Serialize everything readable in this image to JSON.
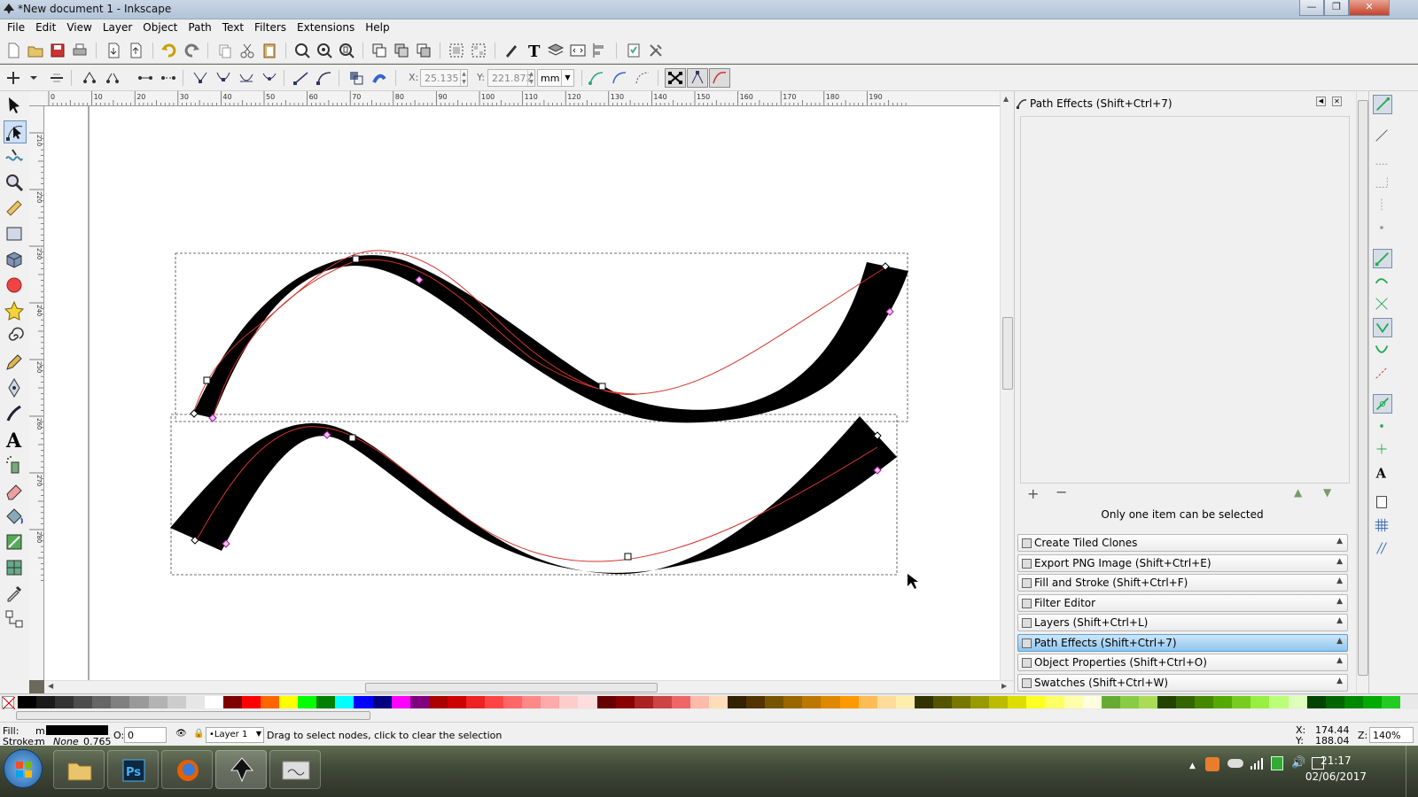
{
  "window": {
    "title": "*New document 1 - Inkscape"
  },
  "menu": [
    "File",
    "Edit",
    "View",
    "Layer",
    "Object",
    "Path",
    "Text",
    "Filters",
    "Extensions",
    "Help"
  ],
  "node_toolbar": {
    "x_label": "X:",
    "x_value": "25.135",
    "y_label": "Y:",
    "y_value": "221.872",
    "unit": "mm"
  },
  "ruler_h": [
    "0",
    "10",
    "20",
    "30",
    "40",
    "50",
    "60",
    "70",
    "80",
    "90",
    "100",
    "110",
    "120",
    "130",
    "140",
    "150",
    "160",
    "170",
    "180",
    "190"
  ],
  "ruler_v": [
    "210",
    "220",
    "230",
    "240",
    "250",
    "260",
    "270",
    "280"
  ],
  "dock": {
    "title": "Path Effects  (Shift+Ctrl+7)",
    "hint": "Only one item can be selected",
    "panels": [
      {
        "label": "Create Tiled Clones",
        "active": false
      },
      {
        "label": "Export PNG Image (Shift+Ctrl+E)",
        "active": false
      },
      {
        "label": "Fill and Stroke (Shift+Ctrl+F)",
        "active": false
      },
      {
        "label": "Filter Editor",
        "active": false
      },
      {
        "label": "Layers (Shift+Ctrl+L)",
        "active": false
      },
      {
        "label": "Path Effects  (Shift+Ctrl+7)",
        "active": true
      },
      {
        "label": "Object Properties (Shift+Ctrl+O)",
        "active": false
      },
      {
        "label": "Swatches (Shift+Ctrl+W)",
        "active": false
      }
    ]
  },
  "status": {
    "fill_label": "Fill:",
    "fill_value": "m",
    "stroke_label": "Stroke:",
    "stroke_value": "m",
    "stroke_none": "None",
    "stroke_width": "0.765",
    "opacity_label": "O:",
    "opacity_value": "0",
    "layer": "•Layer 1",
    "message": "Drag to select nodes, click to clear the selection",
    "cursor_x_label": "X:",
    "cursor_x": "174.44",
    "cursor_y_label": "Y:",
    "cursor_y": "188.04",
    "zoom_label": "Z:",
    "zoom": "140%"
  },
  "taskbar": {
    "time": "21:17",
    "date": "02/06/2017"
  },
  "colors": {
    "accent": "#8fc6ef",
    "path_red": "#c0392b",
    "node_pink": "#d61fc4"
  }
}
